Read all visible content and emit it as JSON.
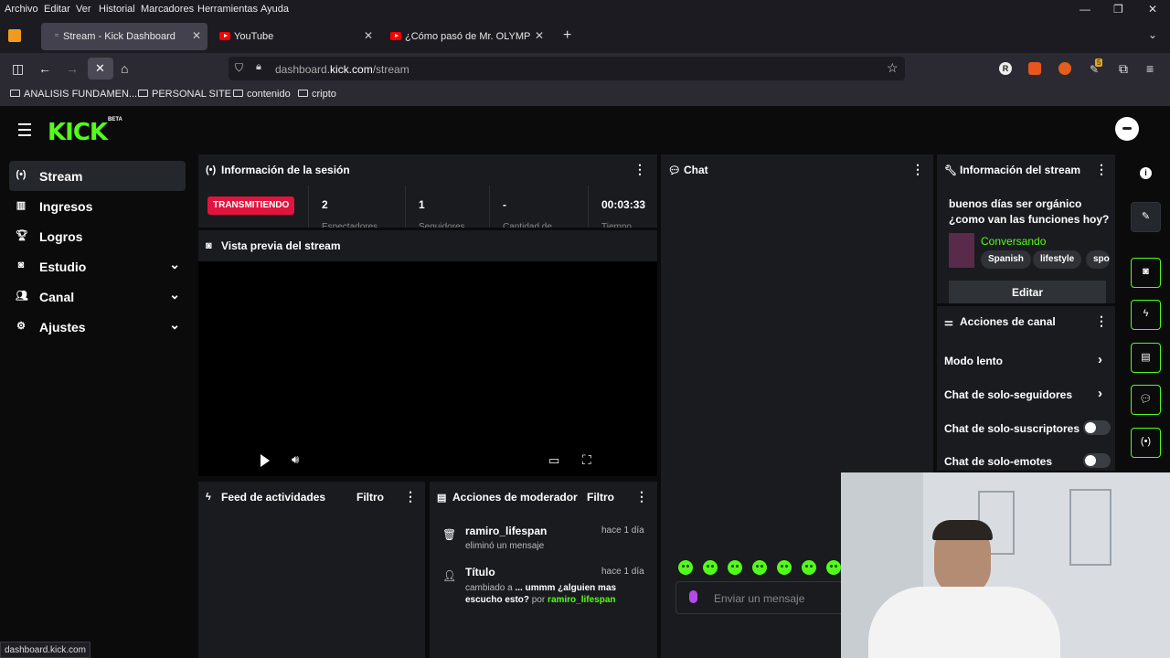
{
  "menubar": {
    "items": [
      "Archivo",
      "Editar",
      "Ver",
      "Historial",
      "Marcadores",
      "Herramientas",
      "Ayuda"
    ]
  },
  "tabs": [
    {
      "title": "Stream - Kick Dashboard",
      "active": true
    },
    {
      "title": "YouTube",
      "active": false
    },
    {
      "title": "¿Cómo pasó de Mr. OLYMPIA a",
      "active": false
    }
  ],
  "address": {
    "host": "dashboard.kick.com",
    "path": "/stream",
    "prefix": "dashboard.",
    "domain": "kick.com"
  },
  "toolbar_ext": {
    "badge": "5"
  },
  "bookmarks": [
    "ANALISIS FUNDAMEN...",
    "PERSONAL SITE",
    "contenido",
    "cripto"
  ],
  "brand": {
    "logo": "KICK",
    "beta": "BETA",
    "accent": "#53fc18"
  },
  "sidebar": [
    {
      "label": "Stream",
      "icon": "broadcast-icon",
      "active": true,
      "expandable": false
    },
    {
      "label": "Ingresos",
      "icon": "chart-icon",
      "active": false,
      "expandable": false
    },
    {
      "label": "Logros",
      "icon": "trophy-icon",
      "active": false,
      "expandable": false
    },
    {
      "label": "Estudio",
      "icon": "studio-icon",
      "active": false,
      "expandable": true
    },
    {
      "label": "Canal",
      "icon": "users-icon",
      "active": false,
      "expandable": true
    },
    {
      "label": "Ajustes",
      "icon": "gear-icon",
      "active": false,
      "expandable": true
    }
  ],
  "session": {
    "title": "Información de la sesión",
    "status": "TRANSMITIENDO",
    "stats": [
      {
        "value": "2",
        "label": "Espectadores"
      },
      {
        "value": "1",
        "label": "Seguidores"
      },
      {
        "value": "-",
        "label": "Cantidad de"
      },
      {
        "value": "00:03:33",
        "label": "Tiempo"
      }
    ]
  },
  "preview": {
    "title": "Vista previa del stream"
  },
  "feed": {
    "title": "Feed de actividades",
    "filter": "Filtro"
  },
  "modactions": {
    "title": "Acciones de moderador",
    "filter": "Filtro",
    "items": [
      {
        "user": "ramiro_lifespan",
        "time": "hace 1 día",
        "desc": "eliminó un mensaje"
      },
      {
        "user": "Título",
        "time": "hace 1 día",
        "desc1": "cambiado a ",
        "quote": "... ummm ¿alguien mas escucho esto?",
        "by": " por ",
        "byuser": "ramiro_lifespan"
      }
    ]
  },
  "chat": {
    "title": "Chat",
    "placeholder": "Enviar un mensaje"
  },
  "streaminfo": {
    "title": "Información del stream",
    "stream_title": "buenos días ser orgánico ¿como van las funciones hoy?",
    "category": "Conversando",
    "tags": [
      "Spanish",
      "lifestyle",
      "spo"
    ],
    "edit": "Editar"
  },
  "channel_actions": {
    "title": "Acciones de canal",
    "items": [
      {
        "label": "Modo lento",
        "type": "arrow"
      },
      {
        "label": "Chat de solo-seguidores",
        "type": "arrow"
      },
      {
        "label": "Chat de solo-suscriptores",
        "type": "toggle"
      },
      {
        "label": "Chat de solo-emotes",
        "type": "toggle"
      }
    ]
  },
  "status_url": "dashboard.kick.com"
}
